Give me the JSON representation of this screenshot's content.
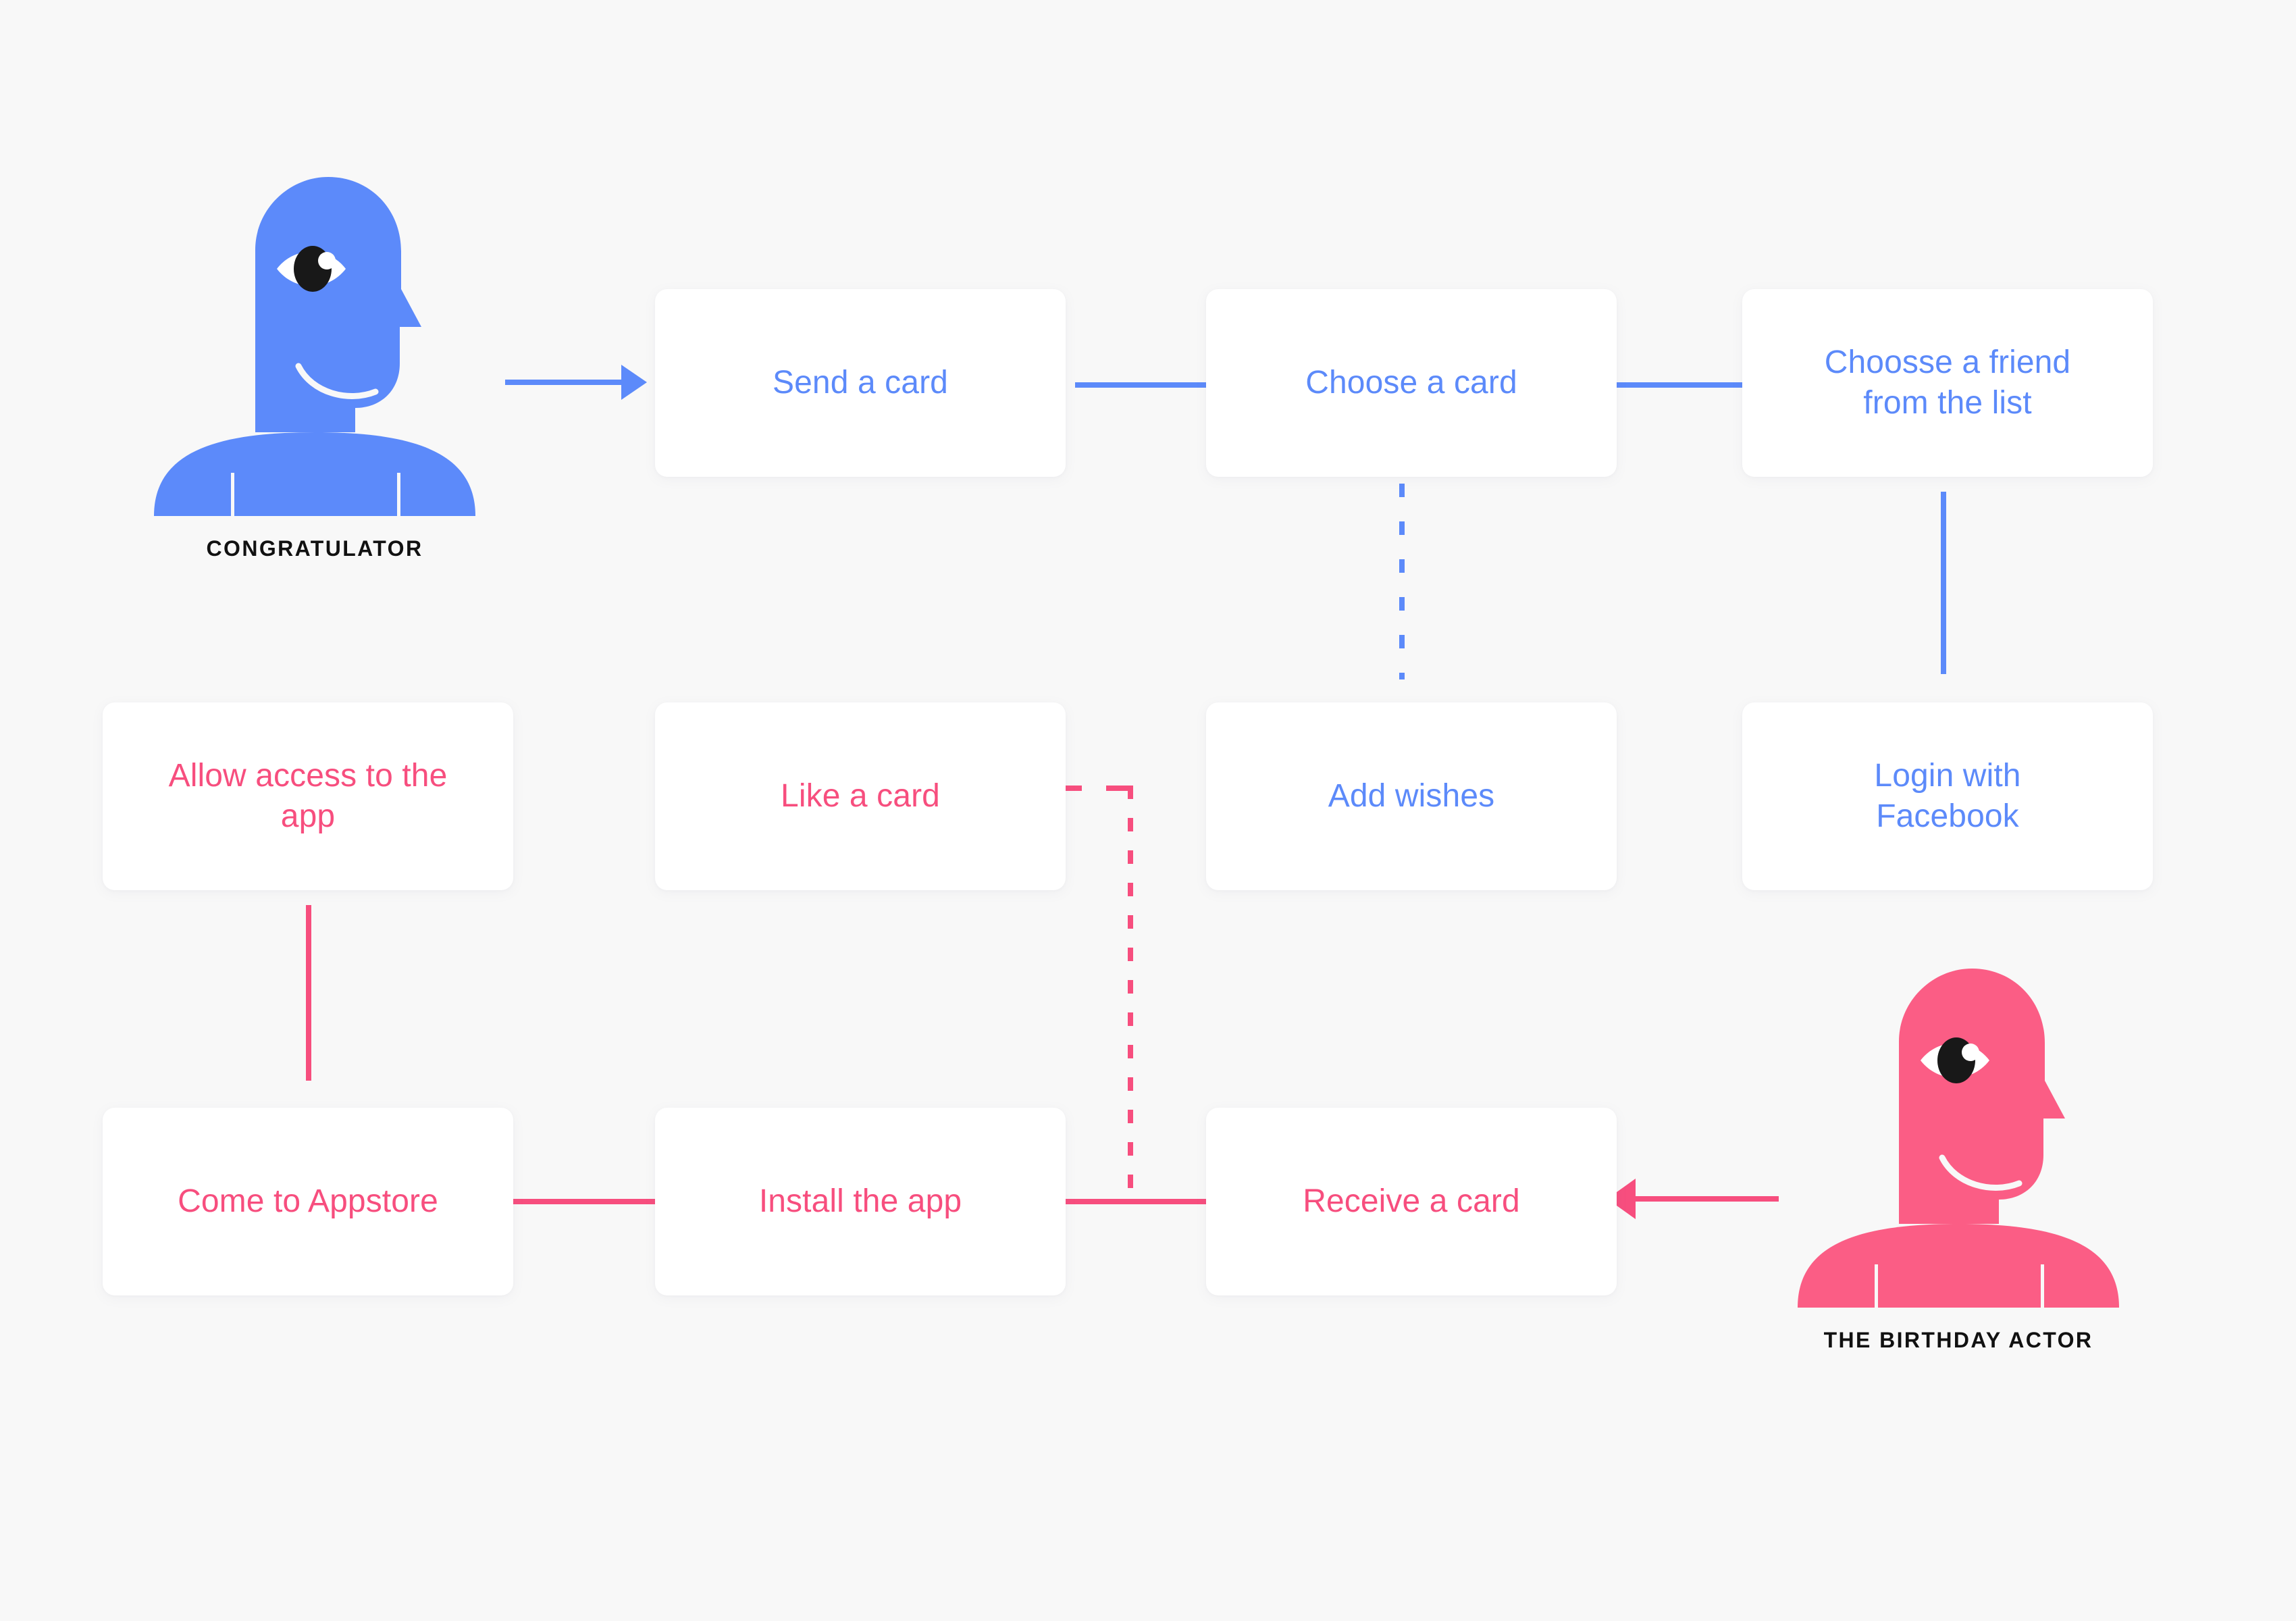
{
  "background_color": "#F8F8F8",
  "palette": {
    "blue": "#5C8AFA",
    "pink": "#F74E7E",
    "persona_blue": "#5C8AFA",
    "persona_pink": "#FB5D85",
    "card_background": "#FFFFFF",
    "label_text": "#111111"
  },
  "personas": [
    {
      "id": "congratulator",
      "label": "CONGRATULATOR",
      "color": "#5C8AFA",
      "facing": "right"
    },
    {
      "id": "birthday-actor",
      "label": "THE BIRTHDAY ACTOR",
      "color": "#FB5D85",
      "facing": "right"
    }
  ],
  "cards": [
    {
      "id": "send-a-card",
      "label": "Send a card",
      "color": "blue",
      "row": 1,
      "col": 2
    },
    {
      "id": "choose-a-card",
      "label": "Choose a card",
      "color": "blue",
      "row": 1,
      "col": 3
    },
    {
      "id": "choose-a-friend",
      "label": "Choosse a friend\nfrom the list",
      "color": "blue",
      "row": 1,
      "col": 4
    },
    {
      "id": "allow-access",
      "label": "Allow access to the\napp",
      "color": "pink",
      "row": 2,
      "col": 1
    },
    {
      "id": "like-a-card",
      "label": "Like a card",
      "color": "pink",
      "row": 2,
      "col": 2
    },
    {
      "id": "add-wishes",
      "label": "Add wishes",
      "color": "blue",
      "row": 2,
      "col": 3
    },
    {
      "id": "login-facebook",
      "label": "Login with\nFacebook",
      "color": "blue",
      "row": 2,
      "col": 4
    },
    {
      "id": "come-to-appstore",
      "label": "Come to Appstore",
      "color": "pink",
      "row": 3,
      "col": 1
    },
    {
      "id": "install-the-app",
      "label": "Install the app",
      "color": "pink",
      "row": 3,
      "col": 2
    },
    {
      "id": "receive-a-card",
      "label": "Receive a card",
      "color": "pink",
      "row": 3,
      "col": 3
    }
  ],
  "connections": [
    {
      "id": "congratulator-to-send",
      "from": "congratulator",
      "to": "send-a-card",
      "style": "arrow",
      "color": "blue",
      "direction": "right"
    },
    {
      "id": "send-to-choose-card",
      "from": "send-a-card",
      "to": "choose-a-card",
      "style": "solid",
      "color": "blue",
      "direction": "right"
    },
    {
      "id": "choose-card-to-friend",
      "from": "choose-a-card",
      "to": "choose-a-friend",
      "style": "solid",
      "color": "blue",
      "direction": "right"
    },
    {
      "id": "choose-card-to-add-wishes",
      "from": "choose-a-card",
      "to": "add-wishes",
      "style": "dashed",
      "color": "blue",
      "direction": "down"
    },
    {
      "id": "friend-to-login",
      "from": "choose-a-friend",
      "to": "login-facebook",
      "style": "solid",
      "color": "blue",
      "direction": "down"
    },
    {
      "id": "allow-to-appstore",
      "from": "allow-access",
      "to": "come-to-appstore",
      "style": "solid",
      "color": "pink",
      "direction": "down"
    },
    {
      "id": "appstore-to-install",
      "from": "come-to-appstore",
      "to": "install-the-app",
      "style": "solid",
      "color": "pink",
      "direction": "right"
    },
    {
      "id": "install-to-receive",
      "from": "install-the-app",
      "to": "receive-a-card",
      "style": "solid",
      "color": "pink",
      "direction": "right"
    },
    {
      "id": "like-card-to-bottom-row",
      "from": "like-a-card",
      "to": "install-to-receive",
      "style": "dashed-elbow",
      "color": "pink",
      "direction": "right-down"
    },
    {
      "id": "birthday-actor-to-receive",
      "from": "birthday-actor",
      "to": "receive-a-card",
      "style": "arrow",
      "color": "pink",
      "direction": "left"
    }
  ]
}
